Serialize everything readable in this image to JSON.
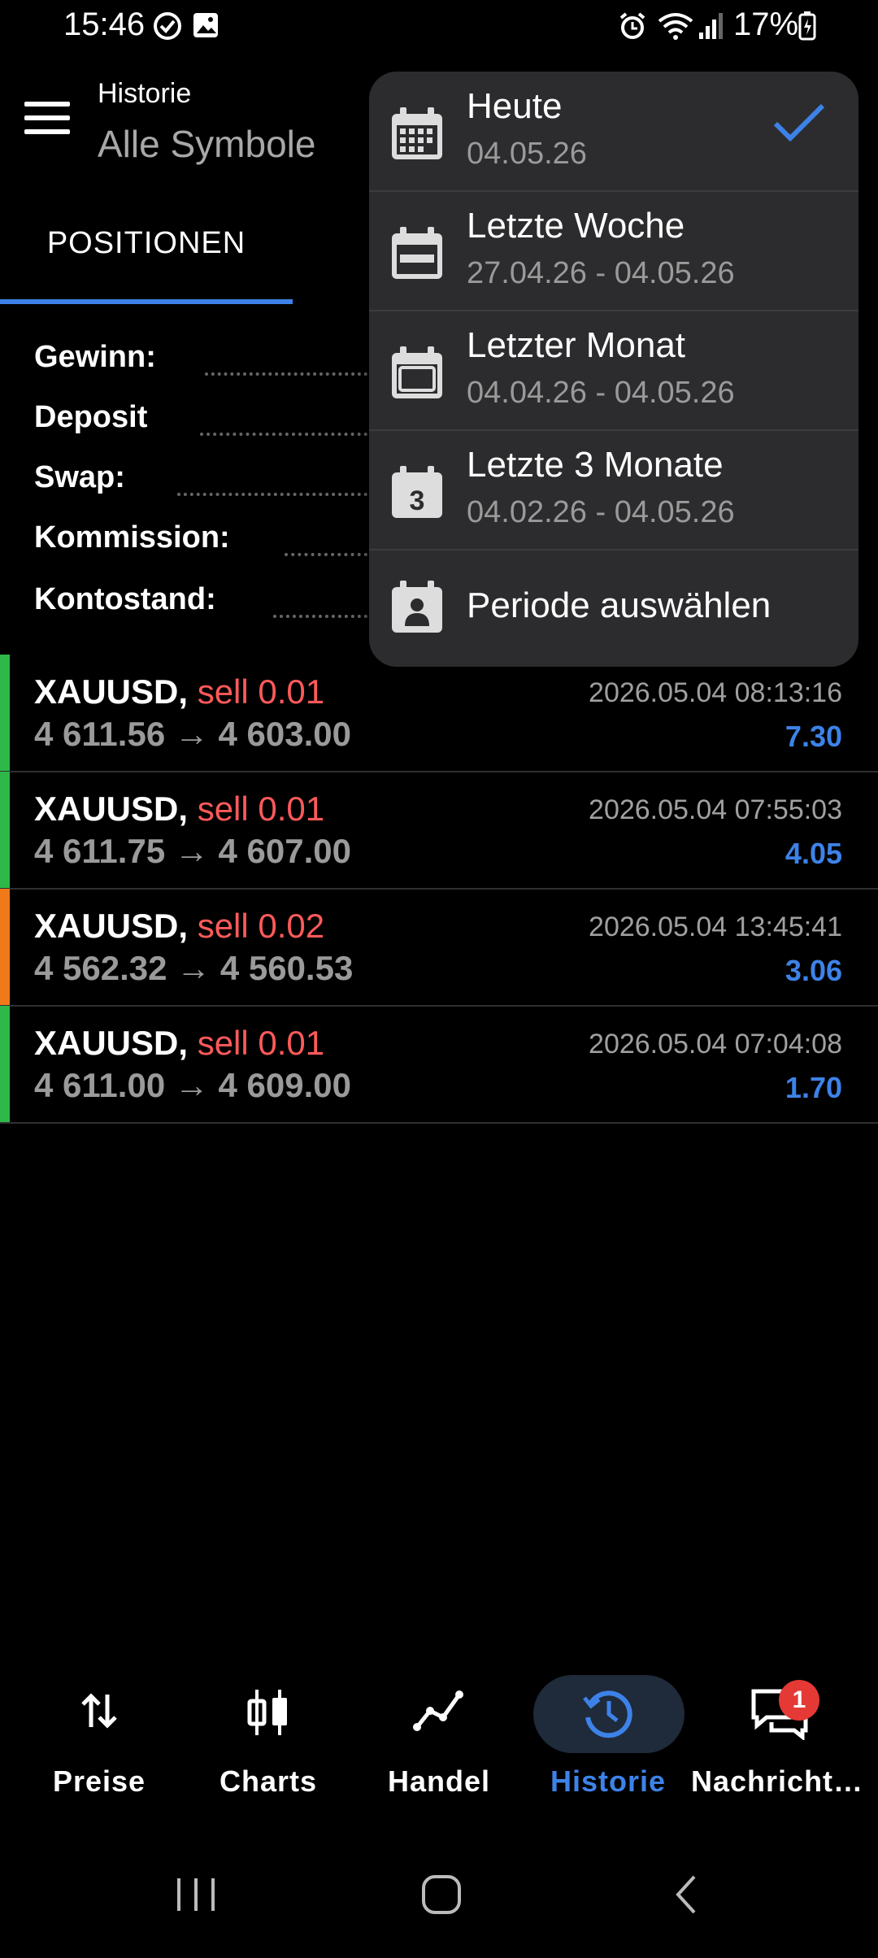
{
  "status_bar": {
    "time": "15:46",
    "battery": "17%"
  },
  "header": {
    "title": "Historie",
    "subtitle": "Alle Symbole"
  },
  "tabs": {
    "positionen": "POSITIONEN"
  },
  "summary": {
    "gewinn": "Gewinn:",
    "deposit": "Deposit",
    "swap": "Swap:",
    "kommission": "Kommission:",
    "kontostand": "Kontostand:"
  },
  "trades": [
    {
      "symbol": "XAUUSD,",
      "side": "sell 0.01",
      "prices": "4 611.56 → 4 603.00",
      "time": "2026.05.04 08:13:16",
      "profit": "7.30",
      "bar_color": "#2fb84a"
    },
    {
      "symbol": "XAUUSD,",
      "side": "sell 0.01",
      "prices": "4 611.75 → 4 607.00",
      "time": "2026.05.04 07:55:03",
      "profit": "4.05",
      "bar_color": "#2fb84a"
    },
    {
      "symbol": "XAUUSD,",
      "side": "sell 0.02",
      "prices": "4 562.32 → 4 560.53",
      "time": "2026.05.04 13:45:41",
      "profit": "3.06",
      "bar_color": "#f07a1a"
    },
    {
      "symbol": "XAUUSD,",
      "side": "sell 0.01",
      "prices": "4 611.00 → 4 609.00",
      "time": "2026.05.04 07:04:08",
      "profit": "1.70",
      "bar_color": "#2fb84a"
    }
  ],
  "dropdown": {
    "items": [
      {
        "title": "Heute",
        "subtitle": "04.05.26",
        "icon": "calendar-day-icon",
        "selected": true
      },
      {
        "title": "Letzte Woche",
        "subtitle": "27.04.26 - 04.05.26",
        "icon": "calendar-week-icon"
      },
      {
        "title": "Letzter Monat",
        "subtitle": "04.04.26 - 04.05.26",
        "icon": "calendar-month-icon"
      },
      {
        "title": "Letzte 3 Monate",
        "subtitle": "04.02.26 - 04.05.26",
        "icon": "calendar-3-icon",
        "icon_text": "3"
      },
      {
        "title": "Periode auswählen",
        "icon": "calendar-custom-icon"
      }
    ]
  },
  "bottom_nav": {
    "preise": "Preise",
    "charts": "Charts",
    "handel": "Handel",
    "historie": "Historie",
    "nachrichten": "Nachricht…",
    "badge": "1",
    "active": "historie"
  },
  "colors": {
    "accent": "#3d82e8",
    "sell": "#ff5a5a",
    "win": "#2fb84a",
    "orange": "#f07a1a"
  }
}
